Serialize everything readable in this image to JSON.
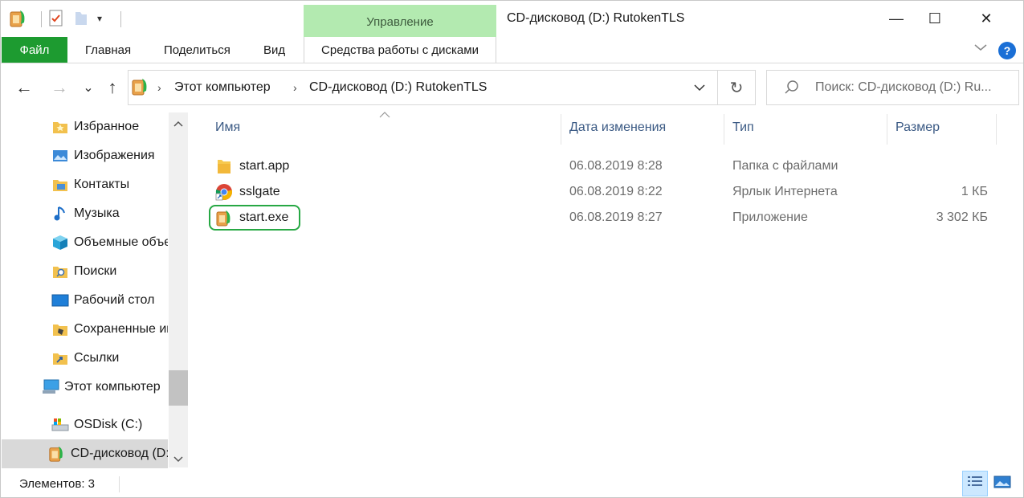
{
  "window": {
    "title": "CD-дисковод (D:) RutokenTLS",
    "context_group": "Управление",
    "minimize": "—",
    "maximize": "☐",
    "close": "✕"
  },
  "ribbon": {
    "tabs": [
      "Файл",
      "Главная",
      "Поделиться",
      "Вид",
      "Средства работы с дисками"
    ],
    "accent_color": "#1d9b30",
    "help": "?"
  },
  "nav": {
    "back": "←",
    "forward": "→",
    "recent": "⌄",
    "up": "↑",
    "breadcrumb": [
      "Этот компьютер",
      "CD-дисковод (D:) RutokenTLS"
    ],
    "refresh": "↻",
    "search_placeholder": "Поиск: CD-дисковод (D:) Ru..."
  },
  "sidebar": {
    "items": [
      {
        "label": "Избранное",
        "icon": "star-folder-icon"
      },
      {
        "label": "Изображения",
        "icon": "pictures-icon"
      },
      {
        "label": "Контакты",
        "icon": "contacts-icon"
      },
      {
        "label": "Музыка",
        "icon": "music-icon"
      },
      {
        "label": "Объемные объекты",
        "icon": "3d-objects-icon"
      },
      {
        "label": "Поиски",
        "icon": "searches-icon"
      },
      {
        "label": "Рабочий стол",
        "icon": "desktop-icon"
      },
      {
        "label": "Сохраненные игры",
        "icon": "saved-games-icon"
      },
      {
        "label": "Ссылки",
        "icon": "links-icon"
      },
      {
        "label": "Этот компьютер",
        "icon": "computer-icon"
      },
      {
        "label": "OSDisk (C:)",
        "icon": "disk-icon"
      },
      {
        "label": "CD-дисковод (D:) RutokenTLS",
        "icon": "rutoken-drive-icon"
      }
    ]
  },
  "list": {
    "columns": [
      "Имя",
      "Дата изменения",
      "Тип",
      "Размер"
    ],
    "rows": [
      {
        "name": "start.app",
        "date": "06.08.2019 8:28",
        "type": "Папка с файлами",
        "size": "",
        "icon": "folder-icon"
      },
      {
        "name": "sslgate",
        "date": "06.08.2019 8:22",
        "type": "Ярлык Интернета",
        "size": "1 КБ",
        "icon": "chrome-shortcut-icon"
      },
      {
        "name": "start.exe",
        "date": "06.08.2019 8:27",
        "type": "Приложение",
        "size": "3 302 КБ",
        "icon": "rutoken-app-icon"
      }
    ],
    "highlight_color": "#27a844"
  },
  "status": {
    "items_count": "Элементов: 3"
  }
}
